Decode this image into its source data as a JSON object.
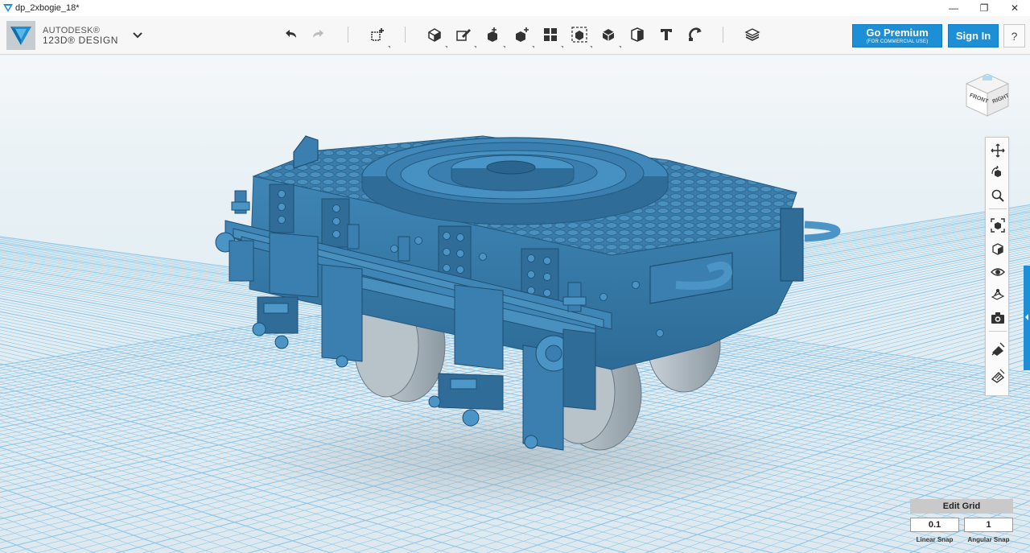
{
  "window": {
    "title": "dp_2xbogie_18*",
    "minimize": "—",
    "maximize": "❐",
    "close": "✕"
  },
  "brand": {
    "line1": "AUTODESK®",
    "line2": "123D® DESIGN"
  },
  "toolbar": {
    "tools": [
      {
        "name": "undo-icon",
        "label": "Undo"
      },
      {
        "name": "redo-icon",
        "label": "Redo"
      },
      {
        "name": "transform-icon",
        "label": "Transform"
      },
      {
        "name": "primitives-icon",
        "label": "Primitives"
      },
      {
        "name": "sketch-icon",
        "label": "Sketch"
      },
      {
        "name": "construct-icon",
        "label": "Construct"
      },
      {
        "name": "modify-icon",
        "label": "Modify"
      },
      {
        "name": "pattern-icon",
        "label": "Pattern"
      },
      {
        "name": "grouping-icon",
        "label": "Grouping"
      },
      {
        "name": "combine-icon",
        "label": "Combine"
      },
      {
        "name": "measure-icon",
        "label": "Measure"
      },
      {
        "name": "text-icon",
        "label": "Text"
      },
      {
        "name": "snap-icon",
        "label": "Snap"
      },
      {
        "name": "material-icon",
        "label": "Material"
      }
    ],
    "premium_label": "Go Premium",
    "premium_sub": "(FOR COMMERCIAL USE)",
    "signin_label": "Sign In",
    "help_label": "?"
  },
  "viewcube": {
    "front": "FRONT",
    "right": "RIGHT"
  },
  "navbar": [
    {
      "name": "pan-icon"
    },
    {
      "name": "orbit-icon"
    },
    {
      "name": "zoom-icon"
    },
    {
      "name": "fit-icon"
    },
    {
      "name": "views-icon"
    },
    {
      "name": "visibility-icon"
    },
    {
      "name": "grid-toggle-icon"
    },
    {
      "name": "screenshot-icon"
    },
    {
      "name": "materials-outline-icon"
    },
    {
      "name": "materials-shaded-icon"
    }
  ],
  "editgrid": {
    "title": "Edit Grid",
    "linear_value": "0.1",
    "angular_value": "1",
    "linear_label": "Linear Snap",
    "angular_label": "Angular Snap"
  },
  "colors": {
    "accent": "#1d8fd7",
    "model": "#3b7fad",
    "grid": "#8fc6e6"
  }
}
